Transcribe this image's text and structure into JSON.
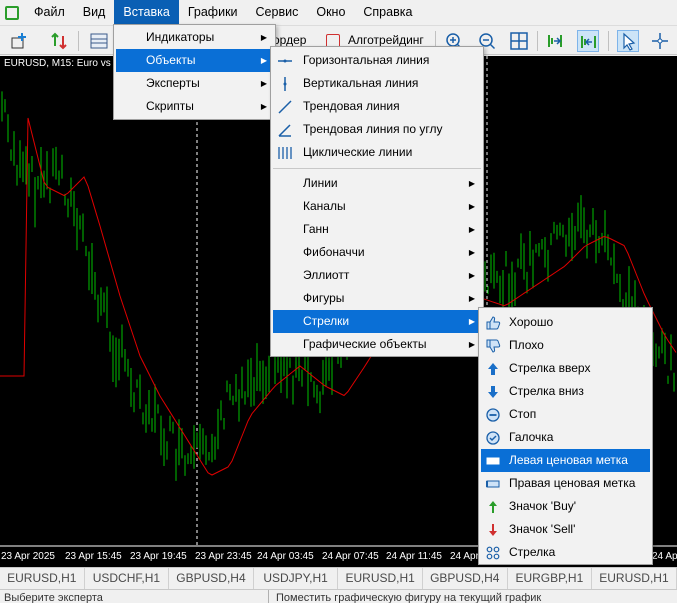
{
  "menubar": {
    "items": [
      "Файл",
      "Вид",
      "Вставка",
      "Графики",
      "Сервис",
      "Окно",
      "Справка"
    ],
    "active_index": 2
  },
  "toolbar": {
    "order_label": "ордер",
    "algotrading_label": "Алготрейдинг"
  },
  "chart": {
    "title": "EURUSD, M15: Euro vs",
    "time_labels": [
      "23 Apr 2025",
      "23 Apr 15:45",
      "23 Apr 19:45",
      "23 Apr 23:45",
      "24 Apr 03:45",
      "24 Apr 07:45",
      "24 Apr 11:45",
      "24 Apr 1",
      "24 Apr 0"
    ],
    "candle_color": "#00c000",
    "ma_color": "#e00000",
    "bg_color": "#000000"
  },
  "insert_menu": {
    "items": [
      {
        "label": "Индикаторы"
      },
      {
        "label": "Объекты"
      },
      {
        "label": "Эксперты"
      },
      {
        "label": "Скрипты"
      }
    ]
  },
  "objects_menu": {
    "lines": [
      {
        "label": "Горизонтальная линия",
        "icon": "horizontal-line-icon"
      },
      {
        "label": "Вертикальная линия",
        "icon": "vertical-line-icon"
      },
      {
        "label": "Трендовая линия",
        "icon": "trendline-icon"
      },
      {
        "label": "Трендовая линия по углу",
        "icon": "trend-angle-icon"
      },
      {
        "label": "Циклические линии",
        "icon": "cycle-lines-icon"
      }
    ],
    "submenus": [
      {
        "label": "Линии"
      },
      {
        "label": "Каналы"
      },
      {
        "label": "Ганн"
      },
      {
        "label": "Фибоначчи"
      },
      {
        "label": "Эллиотт"
      },
      {
        "label": "Фигуры"
      },
      {
        "label": "Стрелки"
      },
      {
        "label": "Графические объекты"
      }
    ]
  },
  "arrows_menu": {
    "items": [
      {
        "label": "Хорошо",
        "icon": "thumbs-up-icon"
      },
      {
        "label": "Плохо",
        "icon": "thumbs-down-icon"
      },
      {
        "label": "Стрелка вверх",
        "icon": "arrow-up-icon"
      },
      {
        "label": "Стрелка вниз",
        "icon": "arrow-down-icon"
      },
      {
        "label": "Стоп",
        "icon": "stop-icon"
      },
      {
        "label": "Галочка",
        "icon": "check-icon"
      },
      {
        "label": "Левая ценовая метка",
        "icon": "left-price-label-icon"
      },
      {
        "label": "Правая ценовая метка",
        "icon": "right-price-label-icon"
      },
      {
        "label": "Значок 'Buy'",
        "icon": "buy-icon"
      },
      {
        "label": "Значок 'Sell'",
        "icon": "sell-icon"
      },
      {
        "label": "Стрелка",
        "icon": "arrow-icon"
      }
    ]
  },
  "tabs": [
    "EURUSD,H1",
    "USDCHF,H1",
    "GBPUSD,H4",
    "USDJPY,H1",
    "EURUSD,H1",
    "GBPUSD,H4",
    "EURGBP,H1",
    "EURUSD,H1"
  ],
  "status": {
    "left": "Выберите эксперта",
    "right": "Поместить графическую фигуру на текущий график"
  }
}
